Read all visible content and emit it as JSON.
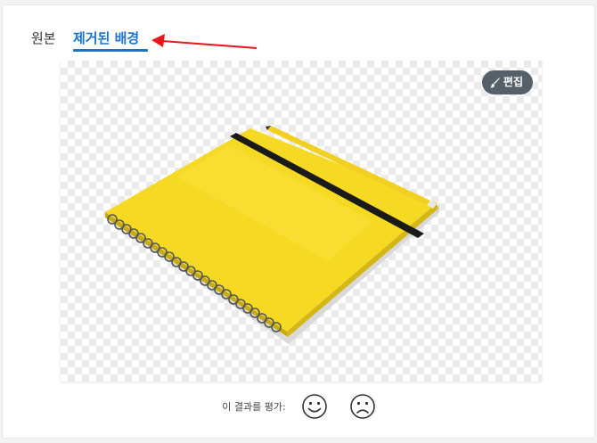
{
  "tabs": [
    {
      "label": "원본",
      "active": false
    },
    {
      "label": "제거된 배경",
      "active": true
    }
  ],
  "colors": {
    "accent": "#1d72c9",
    "annotation_arrow": "#e8171b",
    "edit_button_bg": "#56606b",
    "notebook_cover": "#f5d923",
    "elastic_band": "#1a1a1a"
  },
  "editor": {
    "edit_button_label": "편집",
    "edit_button_icon": "brush-icon",
    "background": "transparent-checkerboard"
  },
  "rating": {
    "label": "이 결과를 평가:",
    "options": [
      {
        "icon": "smile-face-icon"
      },
      {
        "icon": "sad-face-icon"
      }
    ]
  }
}
